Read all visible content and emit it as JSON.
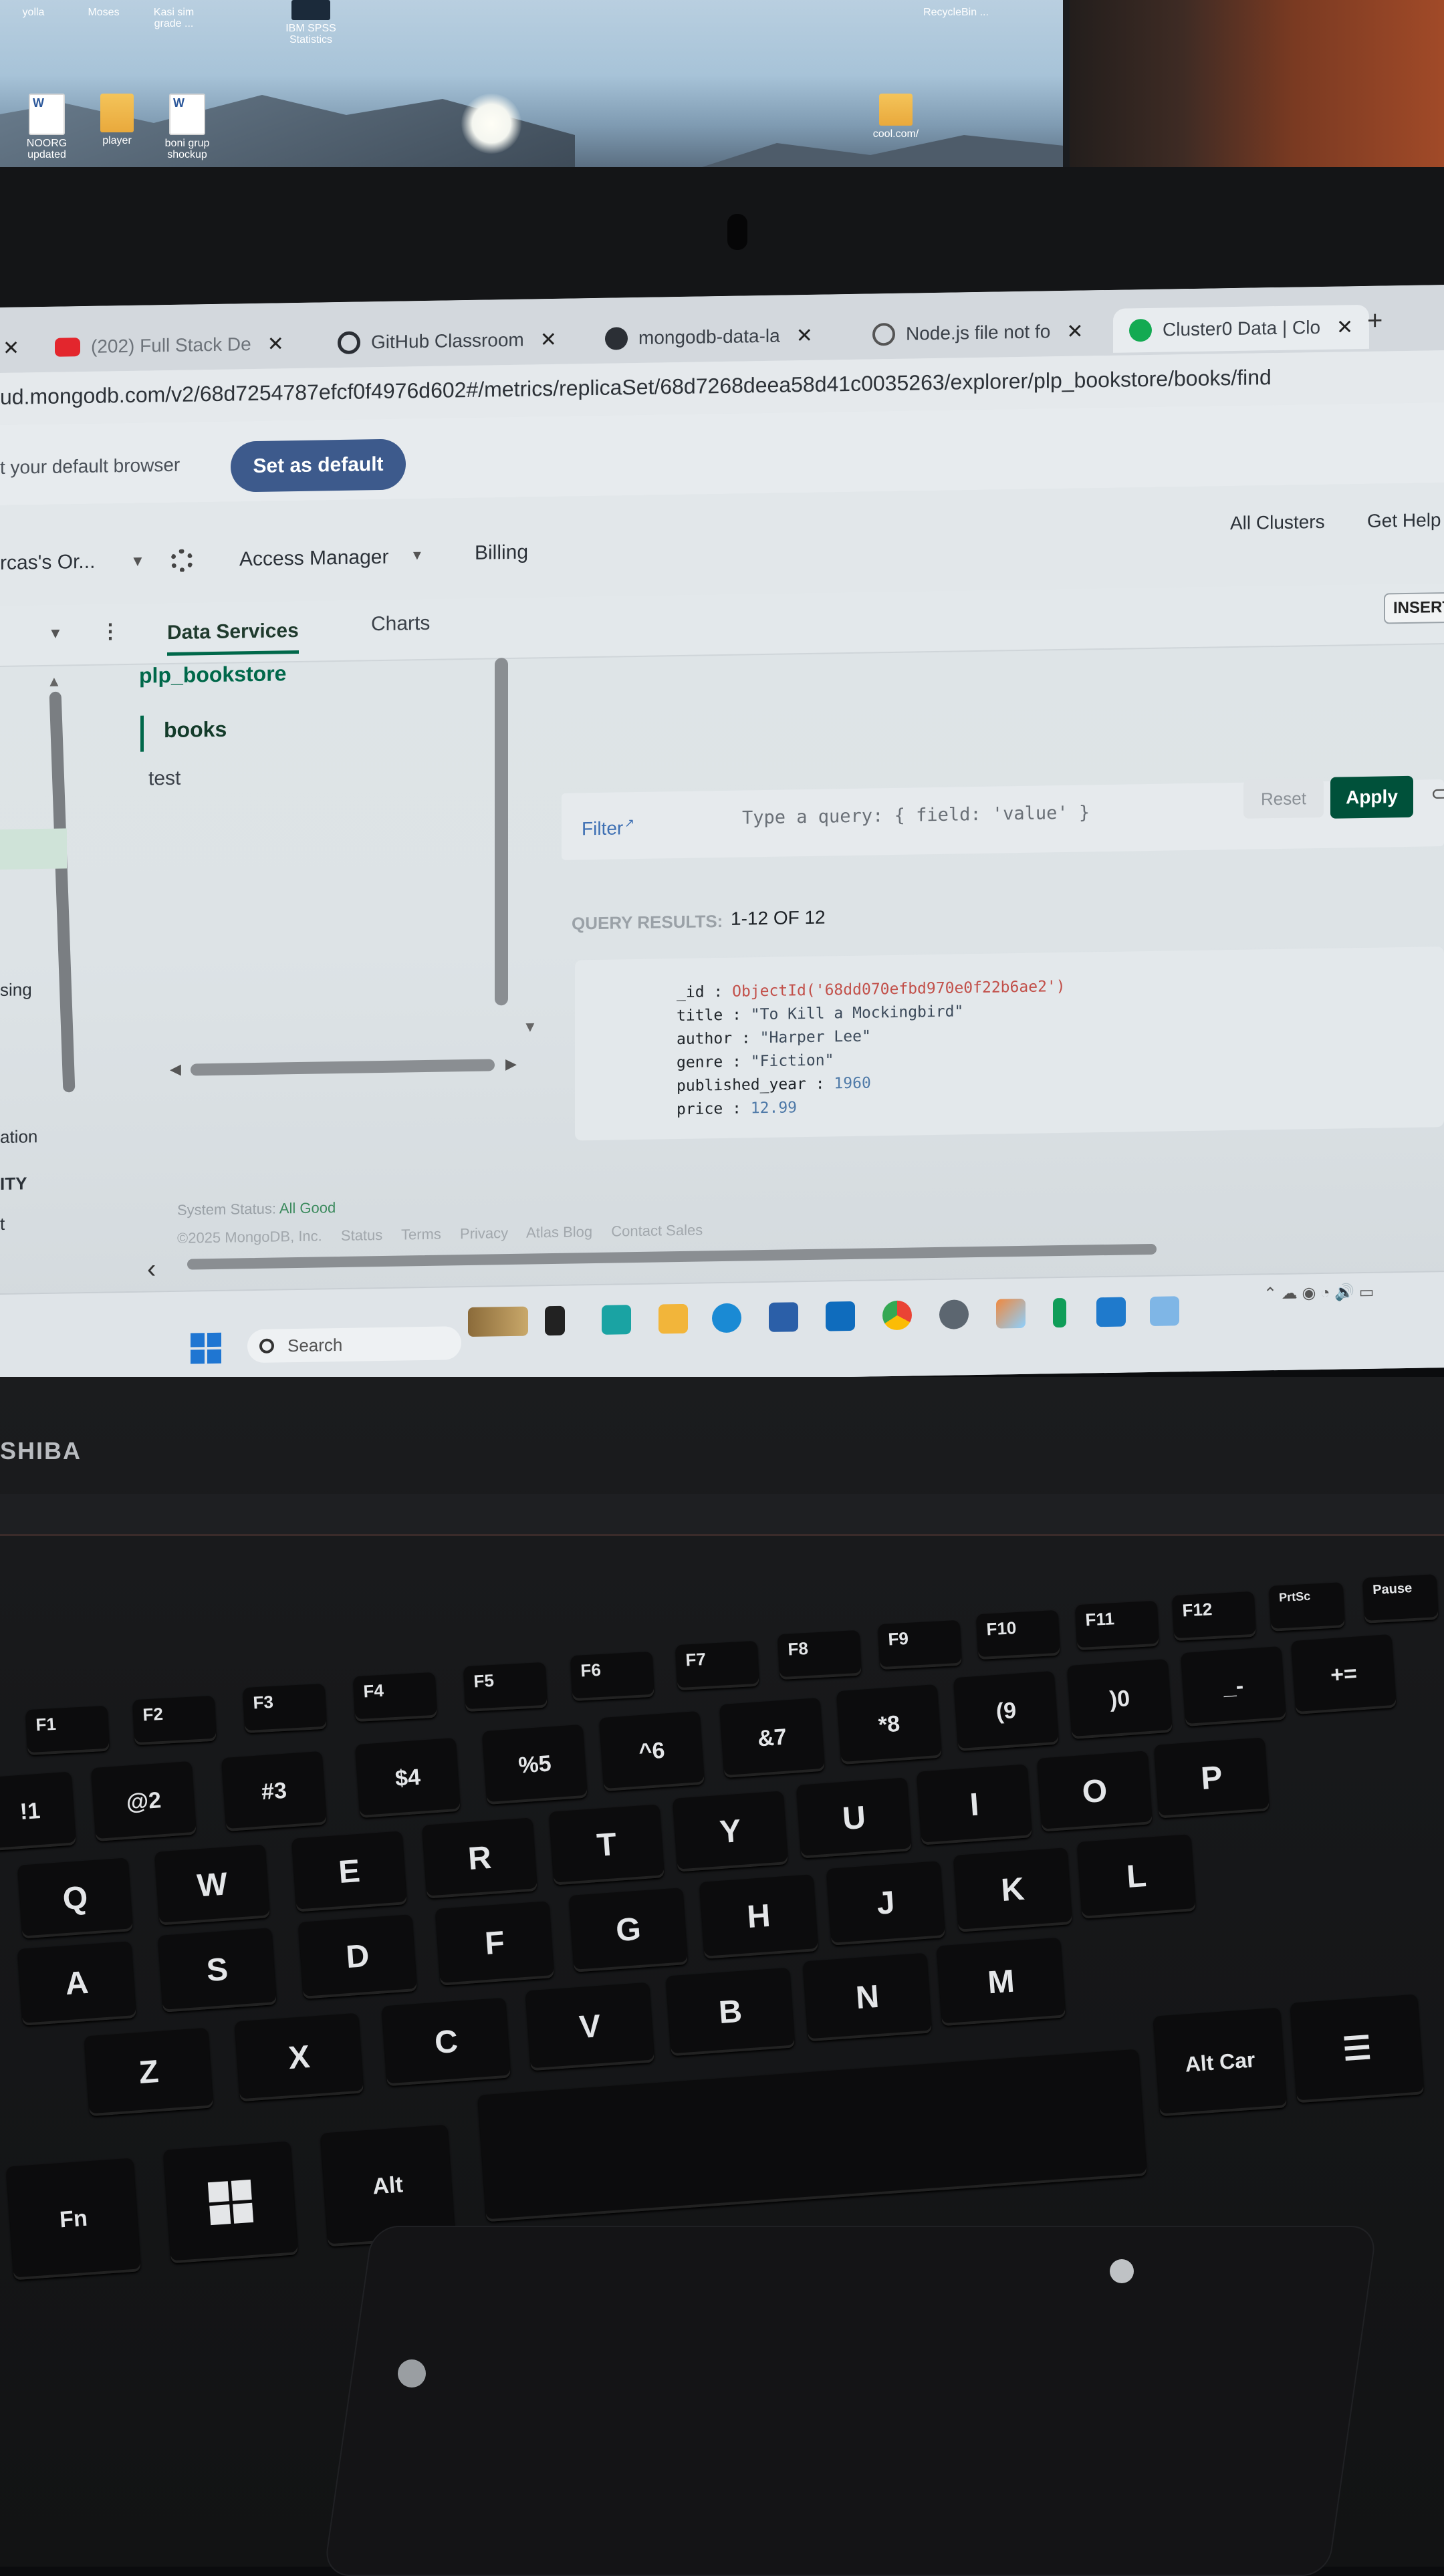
{
  "desktop": {
    "icons": [
      {
        "label": "yolla"
      },
      {
        "label": "Moses"
      },
      {
        "label": "Kasi sim grade ..."
      },
      {
        "label": "IBM SPSS Statistics"
      },
      {
        "label": "NOORG updated"
      },
      {
        "label": "player"
      },
      {
        "label": "boni grup shockup"
      },
      {
        "label": "cool.com/"
      },
      {
        "label": "RecycleBin ..."
      }
    ]
  },
  "browser": {
    "tabs": [
      {
        "label": "(202) Full Stack De",
        "icon": "youtube-icon"
      },
      {
        "label": "GitHub Classroom",
        "icon": "github-classroom-icon"
      },
      {
        "label": "mongodb-data-la",
        "icon": "github-icon"
      },
      {
        "label": "Node.js file not fo",
        "icon": "openai-icon"
      },
      {
        "label": "Cluster0 Data | Clo",
        "icon": "mongodb-leaf-icon"
      }
    ],
    "url": "ud.mongodb.com/v2/68d7254787efcf0f4976d602#/metrics/replicaSet/68d7268deea58d41c0035263/explorer/plp_bookstore/books/find",
    "banner_text": "t your default browser",
    "set_default_label": "Set as default"
  },
  "atlas": {
    "org": "rcas's Or...",
    "access_manager": "Access Manager",
    "billing": "Billing",
    "all_clusters": "All Clusters",
    "get_help": "Get Help",
    "tabs": {
      "data_services": "Data Services",
      "charts": "Charts"
    },
    "insert_label": "INSERT",
    "sidebar": {
      "database": "plp_bookstore",
      "collections": [
        "books",
        "test"
      ],
      "left_labels": [
        "sing",
        "ation",
        "ITY",
        "t"
      ]
    },
    "filter": {
      "label": "Filter",
      "placeholder": "Type a query: { field: 'value' }",
      "reset": "Reset",
      "apply": "Apply"
    },
    "results": {
      "label": "QUERY RESULTS:",
      "count": "1-12 OF 12"
    },
    "document": {
      "id_key": "_id :",
      "id_value": "ObjectId('68dd070efbd970e0f22b6ae2')",
      "title_key": "title :",
      "title_value": "\"To Kill a Mockingbird\"",
      "author_key": "author :",
      "author_value": "\"Harper Lee\"",
      "genre_key": "genre :",
      "genre_value": "\"Fiction\"",
      "year_key": "published_year :",
      "year_value": "1960",
      "price_key": "price :",
      "price_value": "12.99"
    },
    "footer": {
      "status_prefix": "System Status:",
      "status_value": "All Good",
      "links": [
        "©2025 MongoDB, Inc.",
        "Status",
        "Terms",
        "Privacy",
        "Atlas Blog",
        "Contact Sales"
      ]
    }
  },
  "taskbar": {
    "search_placeholder": "Search"
  },
  "laptop": {
    "brand": "SHIBA"
  },
  "keyboard": {
    "fkeys": [
      "F1",
      "F2",
      "F3",
      "F4",
      "F5",
      "F6",
      "F7",
      "F8",
      "F9",
      "F10",
      "F11",
      "F12",
      "PrtSc",
      "Pause"
    ],
    "numbers": [
      "!1",
      "@2",
      "#3",
      "$4",
      "%5",
      "^6",
      "&7",
      "*8",
      "(9",
      ")0",
      "_-",
      "+="
    ],
    "row_q": [
      "Q",
      "W",
      "E",
      "R",
      "T",
      "Y",
      "U",
      "I",
      "O",
      "P"
    ],
    "row_a": [
      "A",
      "S",
      "D",
      "F",
      "G",
      "H",
      "J",
      "K",
      "L"
    ],
    "row_z": [
      "Z",
      "X",
      "C",
      "V",
      "B",
      "N",
      "M"
    ],
    "bottom": {
      "fn": "Fn",
      "alt": "Alt",
      "alt_car": "Alt Car"
    }
  }
}
